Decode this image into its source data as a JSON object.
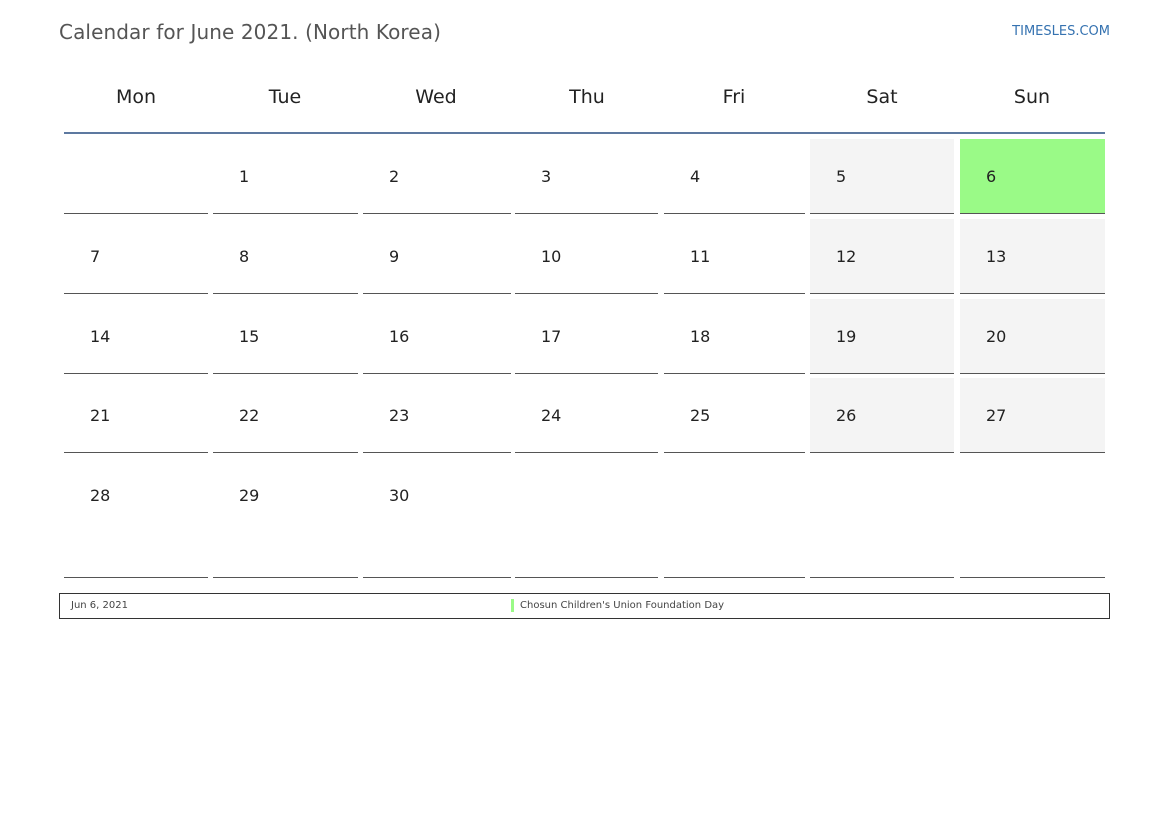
{
  "header": {
    "title": "Calendar for June 2021. (North Korea)",
    "site": "TIMESLES.COM"
  },
  "calendar": {
    "weekdays": [
      "Mon",
      "Tue",
      "Wed",
      "Thu",
      "Fri",
      "Sat",
      "Sun"
    ],
    "weeks": [
      [
        "",
        "1",
        "2",
        "3",
        "4",
        "5",
        "6"
      ],
      [
        "7",
        "8",
        "9",
        "10",
        "11",
        "12",
        "13"
      ],
      [
        "14",
        "15",
        "16",
        "17",
        "18",
        "19",
        "20"
      ],
      [
        "21",
        "22",
        "23",
        "24",
        "25",
        "26",
        "27"
      ],
      [
        "28",
        "29",
        "30",
        "",
        "",
        "",
        ""
      ]
    ],
    "holiday_day": "6",
    "colors": {
      "holiday": "#9afa87",
      "weekend": "#f4f4f4",
      "header_rule": "#5d79a0",
      "link": "#3572b0"
    }
  },
  "legend": {
    "date": "Jun 6, 2021",
    "name": "Chosun Children's Union Foundation Day"
  }
}
